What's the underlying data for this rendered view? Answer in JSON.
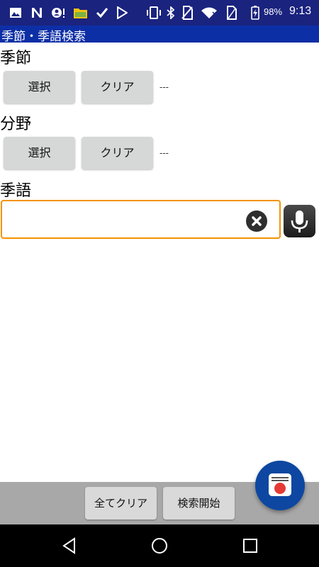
{
  "status_bar": {
    "icons": [
      "photo-icon",
      "n-icon",
      "account-alert-icon",
      "files-icon",
      "check-icon",
      "play-store-icon",
      "vibrate-icon",
      "bluetooth-icon",
      "no-sim-icon",
      "wifi-icon",
      "sim-icon",
      "battery-charging-icon"
    ],
    "battery": "98%",
    "time": "9:13"
  },
  "title_bar": {
    "title": "季節・季語検索"
  },
  "season": {
    "label": "季節",
    "select": "選択",
    "clear": "クリア",
    "value": "---"
  },
  "field": {
    "label": "分野",
    "select": "選択",
    "clear": "クリア",
    "value": "---"
  },
  "kigo": {
    "label": "季語",
    "value": "",
    "placeholder": ""
  },
  "bottom": {
    "clear_all": "全てクリア",
    "search_start": "検索開始"
  },
  "colors": {
    "status_bar": "#1a237e",
    "title_bar": "#0d2fa6",
    "input_border": "#f39200",
    "bottom_bar": "#a8a8a8",
    "fab": "#0d47a1"
  },
  "nav": [
    "back-icon",
    "home-icon",
    "recents-icon"
  ]
}
